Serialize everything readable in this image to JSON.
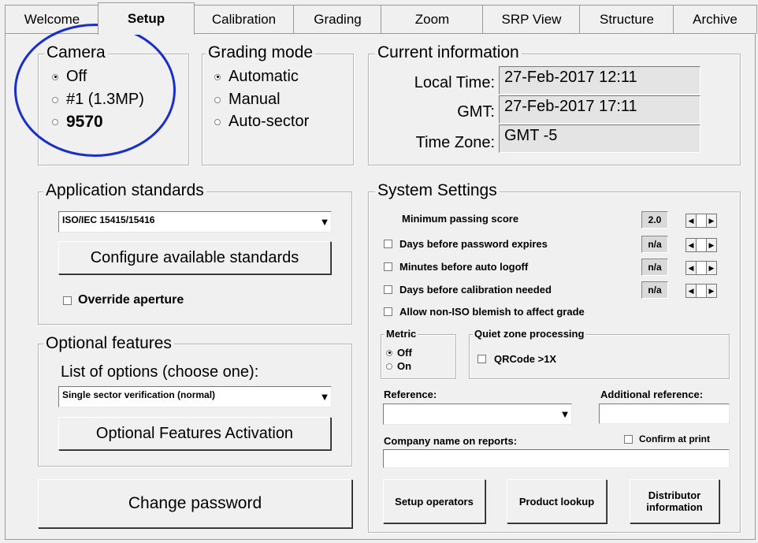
{
  "tabs": [
    "Welcome",
    "Setup",
    "Calibration",
    "Grading",
    "Zoom",
    "SRP View",
    "Structure",
    "Archive"
  ],
  "camera": {
    "title": "Camera",
    "options": [
      "Off",
      "#1 (1.3MP)",
      "9570"
    ],
    "selected": "Off"
  },
  "grading_mode": {
    "title": "Grading mode",
    "options": [
      "Automatic",
      "Manual",
      "Auto-sector"
    ],
    "selected": "Automatic"
  },
  "current_info": {
    "title": "Current information",
    "local_time_label": "Local Time:",
    "local_time": "27-Feb-2017 12:11",
    "gmt_label": "GMT:",
    "gmt": "27-Feb-2017 17:11",
    "tz_label": "Time Zone:",
    "tz": "GMT -5"
  },
  "app_standards": {
    "title": "Application standards",
    "selected": "ISO/IEC 15415/15416",
    "configure_label": "Configure available standards",
    "override_label": "Override aperture"
  },
  "optional": {
    "title": "Optional features",
    "list_label": "List of options (choose one):",
    "selected": "Single sector verification (normal)",
    "activation_label": "Optional Features Activation"
  },
  "change_password_label": "Change password",
  "system": {
    "title": "System Settings",
    "min_score_label": "Minimum passing score",
    "min_score": "2.0",
    "days_pw_label": "Days before password expires",
    "days_pw": "n/a",
    "minutes_logoff_label": "Minutes before auto logoff",
    "minutes_logoff": "n/a",
    "days_cal_label": "Days before calibration needed",
    "days_cal": "n/a",
    "allow_nonIso_label": "Allow non-ISO blemish to affect grade",
    "metric_title": "Metric",
    "metric_options": [
      "Off",
      "On"
    ],
    "metric_selected": "Off",
    "quiet_title": "Quiet zone processing",
    "qrcode_label": "QRCode >1X",
    "reference_label": "Reference:",
    "additional_ref_label": "Additional reference:",
    "company_label": "Company name on reports:",
    "confirm_label": "Confirm at print",
    "setup_operators_label": "Setup operators",
    "product_lookup_label": "Product lookup",
    "distributor_label": "Distributor information"
  },
  "colors": {
    "highlight_circle": "#1a2ec8",
    "background": "#f0f0f0"
  },
  "icons": [
    "radio-icon",
    "checkbox-icon",
    "dropdown-arrow-icon",
    "spin-left-icon",
    "spin-right-icon"
  ]
}
